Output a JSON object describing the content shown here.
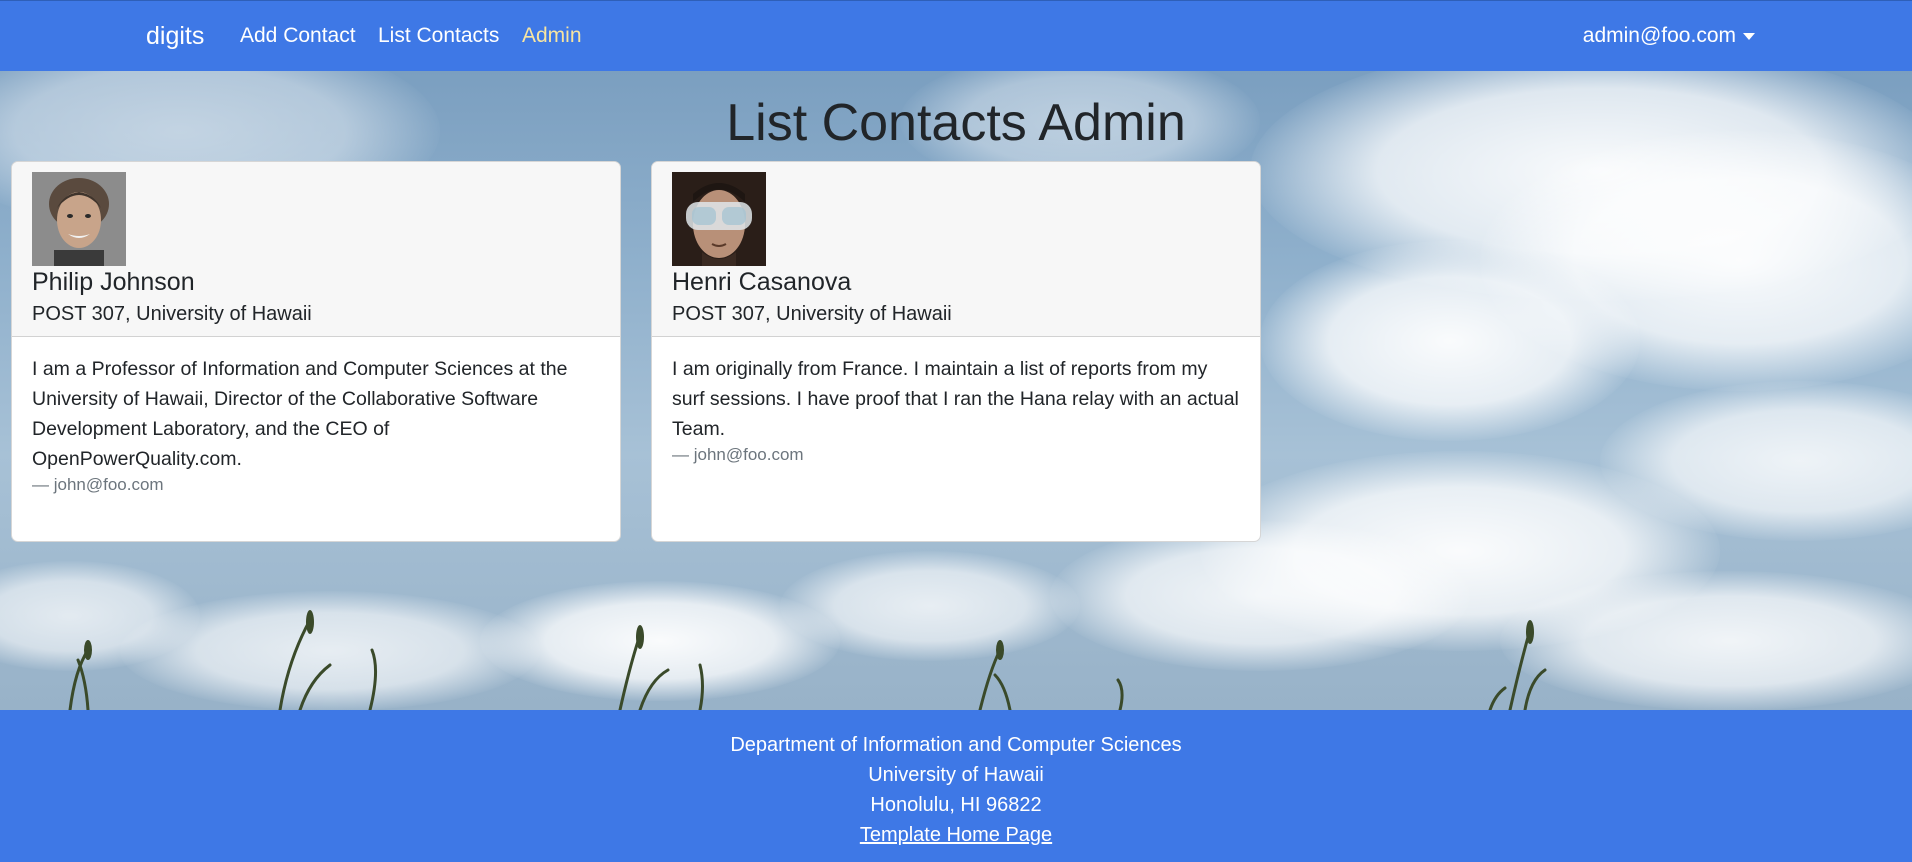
{
  "navbar": {
    "brand": "digits",
    "links": {
      "add_contact": "Add Contact",
      "list_contacts": "List Contacts",
      "admin": "Admin"
    },
    "user": "admin@foo.com",
    "colors": {
      "background": "#3e78e6",
      "active_link": "#f8e5a0"
    }
  },
  "page": {
    "title": "List Contacts Admin"
  },
  "contacts": [
    {
      "name": "Philip Johnson",
      "address": "POST 307, University of Hawaii",
      "description": "I am a Professor of Information and Computer Sciences at the University of Hawaii, Director of the Collaborative Software Development Laboratory, and the CEO of OpenPowerQuality.com.",
      "email": "— john@foo.com"
    },
    {
      "name": "Henri Casanova",
      "address": "POST 307, University of Hawaii",
      "description": "I am originally from France. I maintain a list of reports from my surf sessions. I have proof that I ran the Hana relay with an actual Team.",
      "email": "— john@foo.com"
    }
  ],
  "footer": {
    "line1": "Department of Information and Computer Sciences",
    "line2": "University of Hawaii",
    "line3": "Honolulu, HI 96822",
    "link": "Template Home Page"
  }
}
